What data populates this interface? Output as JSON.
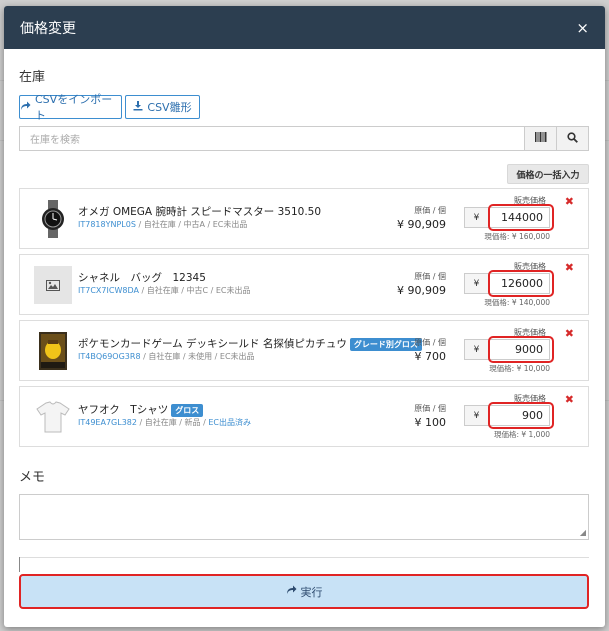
{
  "modal": {
    "title": "価格変更",
    "close": "×"
  },
  "stock_section": {
    "label": "在庫",
    "csv_import_label": "CSVをインポート",
    "csv_template_label": "CSV雛形",
    "search_placeholder": "在庫を検索",
    "bulk_price_label": "価格の一括入力"
  },
  "items": [
    {
      "name": "オメガ OMEGA 腕時計 スピードマスター 3510.50",
      "badge": "",
      "code": "IT7818YNPL0S",
      "meta": " / 自社在庫 / 中古A / EC未出品",
      "ec_link": "",
      "cost_label": "原価 / 個",
      "cost": "¥ 90,909",
      "sale_label": "販売価格",
      "yen": "¥",
      "price": "144000",
      "current": "現価格: ¥ 160,000",
      "thumb": "watch"
    },
    {
      "name": "シャネル　バッグ　12345",
      "badge": "",
      "code": "IT7CX7ICW8DA",
      "meta": " / 自社在庫 / 中古C / EC未出品",
      "ec_link": "",
      "cost_label": "原価 / 個",
      "cost": "¥ 90,909",
      "sale_label": "販売価格",
      "yen": "¥",
      "price": "126000",
      "current": "現価格: ¥ 140,000",
      "thumb": "image-placeholder"
    },
    {
      "name": "ポケモンカードゲーム デッキシールド 名探偵ピカチュウ",
      "badge": "グレード別グロス",
      "code": "IT4BQ69OG3R8",
      "meta": " / 自社在庫 / 未使用 / EC未出品",
      "ec_link": "",
      "cost_label": "原価 / 個",
      "cost": "¥ 700",
      "sale_label": "販売価格",
      "yen": "¥",
      "price": "9000",
      "current": "現価格: ¥ 10,000",
      "thumb": "card"
    },
    {
      "name": "ヤフオク　Tシャツ",
      "badge": "グロス",
      "code": "IT49EA7GL382",
      "meta": " / 自社在庫 / 新品 / ",
      "ec_link": "EC出品済み",
      "cost_label": "原価 / 個",
      "cost": "¥ 100",
      "sale_label": "販売価格",
      "yen": "¥",
      "price": "900",
      "current": "現価格: ¥ 1,000",
      "thumb": "tshirt"
    }
  ],
  "memo": {
    "label": "メモ",
    "value": ""
  },
  "submit": {
    "label": "実行"
  },
  "colors": {
    "header_bg": "#2c3e50",
    "accent": "#3d8ed0",
    "highlight": "#e02424",
    "remove": "#d62b2b",
    "submit_bg": "#c8e2f6"
  }
}
